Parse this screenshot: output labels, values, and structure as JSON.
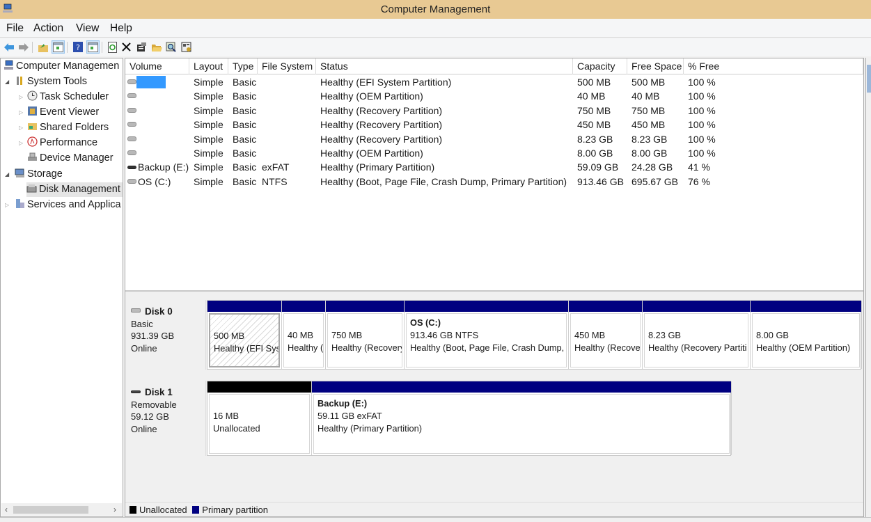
{
  "window": {
    "title": "Computer Management"
  },
  "menu": [
    "File",
    "Action",
    "View",
    "Help"
  ],
  "toolbar": [
    {
      "name": "back-arrow-icon",
      "glyph": "⬅"
    },
    {
      "name": "forward-arrow-icon",
      "glyph": "➡"
    },
    {
      "name": "up-folder-icon",
      "glyph": "↑"
    },
    {
      "name": "show-hide-console-tree-icon",
      "glyph": "▣"
    },
    {
      "name": "help-icon",
      "glyph": "?"
    },
    {
      "name": "show-hide-action-pane-icon",
      "glyph": "▣"
    },
    {
      "name": "refresh-icon",
      "glyph": "↻"
    },
    {
      "name": "delete-icon",
      "glyph": "✕"
    },
    {
      "name": "properties-icon",
      "glyph": "▤"
    },
    {
      "name": "open-folder-icon",
      "glyph": "▱"
    },
    {
      "name": "rescan-disks-icon",
      "glyph": "⌕"
    },
    {
      "name": "settings-icon",
      "glyph": "⚙"
    }
  ],
  "tree": {
    "root": "Computer Managemen",
    "items": [
      {
        "label": "System Tools",
        "level": 1,
        "expanded": true
      },
      {
        "label": "Task Scheduler",
        "level": 2
      },
      {
        "label": "Event Viewer",
        "level": 2
      },
      {
        "label": "Shared Folders",
        "level": 2
      },
      {
        "label": "Performance",
        "level": 2
      },
      {
        "label": "Device Manager",
        "level": 2
      },
      {
        "label": "Storage",
        "level": 1,
        "expanded": true
      },
      {
        "label": "Disk Management",
        "level": 2,
        "selected": true
      },
      {
        "label": "Services and Applica",
        "level": 1
      }
    ]
  },
  "volumes": {
    "columns": [
      "Volume",
      "Layout",
      "Type",
      "File System",
      "Status",
      "Capacity",
      "Free Space",
      "% Free"
    ],
    "rows": [
      {
        "volume": "",
        "layout": "Simple",
        "type": "Basic",
        "fs": "",
        "status": "Healthy (EFI System Partition)",
        "capacity": "500 MB",
        "free": "500 MB",
        "pct": "100 %",
        "selected": true
      },
      {
        "volume": "",
        "layout": "Simple",
        "type": "Basic",
        "fs": "",
        "status": "Healthy (OEM Partition)",
        "capacity": "40 MB",
        "free": "40 MB",
        "pct": "100 %"
      },
      {
        "volume": "",
        "layout": "Simple",
        "type": "Basic",
        "fs": "",
        "status": "Healthy (Recovery Partition)",
        "capacity": "750 MB",
        "free": "750 MB",
        "pct": "100 %"
      },
      {
        "volume": "",
        "layout": "Simple",
        "type": "Basic",
        "fs": "",
        "status": "Healthy (Recovery Partition)",
        "capacity": "450 MB",
        "free": "450 MB",
        "pct": "100 %"
      },
      {
        "volume": "",
        "layout": "Simple",
        "type": "Basic",
        "fs": "",
        "status": "Healthy (Recovery Partition)",
        "capacity": "8.23 GB",
        "free": "8.23 GB",
        "pct": "100 %"
      },
      {
        "volume": "",
        "layout": "Simple",
        "type": "Basic",
        "fs": "",
        "status": "Healthy (OEM Partition)",
        "capacity": "8.00 GB",
        "free": "8.00 GB",
        "pct": "100 %"
      },
      {
        "volume": "Backup (E:)",
        "layout": "Simple",
        "type": "Basic",
        "fs": "exFAT",
        "status": "Healthy (Primary Partition)",
        "capacity": "59.09 GB",
        "free": "24.28 GB",
        "pct": "41 %",
        "removable": true
      },
      {
        "volume": "OS (C:)",
        "layout": "Simple",
        "type": "Basic",
        "fs": "NTFS",
        "status": "Healthy (Boot, Page File, Crash Dump, Primary Partition)",
        "capacity": "913.46 GB",
        "free": "695.67 GB",
        "pct": "76 %"
      }
    ]
  },
  "disks": [
    {
      "name": "Disk 0",
      "kind": "Basic",
      "size": "931.39 GB",
      "state": "Online",
      "partitions": [
        {
          "name": "",
          "line1": "500 MB",
          "line2": "Healthy (EFI Syst",
          "kind": "primary",
          "selected": true
        },
        {
          "name": "",
          "line1": "40 MB",
          "line2": "Healthy (",
          "kind": "primary"
        },
        {
          "name": "",
          "line1": "750 MB",
          "line2": "Healthy (Recovery",
          "kind": "primary"
        },
        {
          "name": "OS  (C:)",
          "line1": "913.46 GB NTFS",
          "line2": "Healthy (Boot, Page File, Crash Dump, F",
          "kind": "primary"
        },
        {
          "name": "",
          "line1": "450 MB",
          "line2": "Healthy (Recove",
          "kind": "primary"
        },
        {
          "name": "",
          "line1": "8.23 GB",
          "line2": "Healthy (Recovery Partiti",
          "kind": "primary"
        },
        {
          "name": "",
          "line1": "8.00 GB",
          "line2": "Healthy (OEM Partition)",
          "kind": "primary"
        }
      ]
    },
    {
      "name": "Disk 1",
      "kind": "Removable",
      "size": "59.12 GB",
      "state": "Online",
      "partitions": [
        {
          "name": "",
          "line1": "16 MB",
          "line2": "Unallocated",
          "kind": "unallocated"
        },
        {
          "name": "Backup  (E:)",
          "line1": "59.11 GB exFAT",
          "line2": "Healthy (Primary Partition)",
          "kind": "primary"
        }
      ]
    }
  ],
  "legend": [
    {
      "label": "Unallocated",
      "color": "#000000"
    },
    {
      "label": "Primary partition",
      "color": "#000080"
    }
  ]
}
